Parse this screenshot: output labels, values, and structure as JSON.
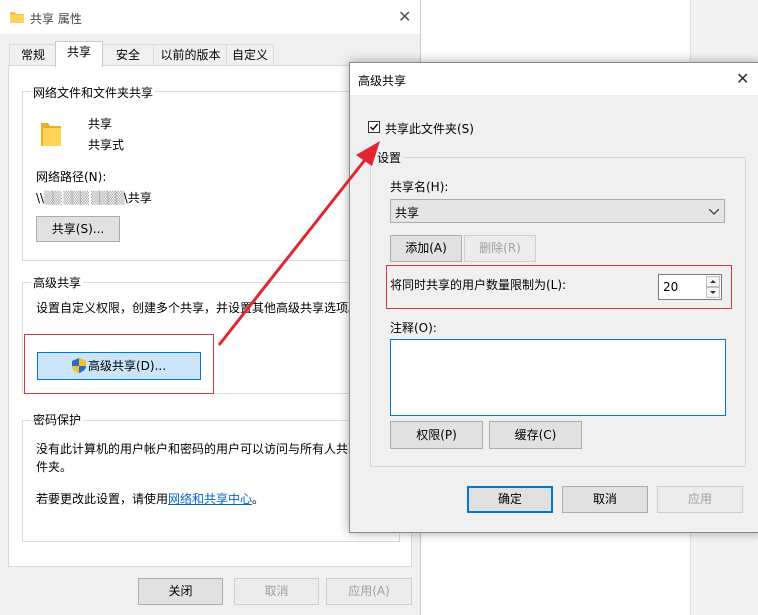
{
  "properties_window": {
    "title": "共享 属性",
    "tabs": [
      "常规",
      "共享",
      "安全",
      "以前的版本",
      "自定义"
    ],
    "network_share_group": "网络文件和文件夹共享",
    "folder_name": "共享",
    "folder_status": "共享式",
    "network_path_label": "网络路径(N):",
    "network_path_prefix": "\\\\",
    "network_path_masked": "▒▒ ▒▒▒ ▒▒▒▒",
    "network_path_suffix": "\\共享",
    "share_button": "共享(S)...",
    "advanced_group": "高级共享",
    "advanced_desc": "设置自定义权限，创建多个共享，并设置其他高级共享选项。",
    "advanced_button": "高级共享(D)...",
    "password_group": "密码保护",
    "password_desc_1": "没有此计算机的用户帐户和密码的用户可以访问与所有人共享的文",
    "password_desc_2": "件夹。",
    "password_change_prefix": "若要更改此设置，请使用",
    "password_link": "网络和共享中心",
    "password_change_suffix": "。",
    "ok_button": "关闭",
    "cancel_button": "取消",
    "apply_button": "应用(A)"
  },
  "advanced_dialog": {
    "title": "高级共享",
    "share_checkbox_label": "共享此文件夹(S)",
    "share_checked": true,
    "settings_group": "设置",
    "share_name_label": "共享名(H):",
    "share_name_value": "共享",
    "add_button": "添加(A)",
    "remove_button": "删除(R)",
    "limit_label": "将同时共享的用户数量限制为(L):",
    "limit_value": "20",
    "comment_label": "注释(O):",
    "comment_value": "",
    "permissions_button": "权限(P)",
    "caching_button": "缓存(C)",
    "ok_button": "确定",
    "cancel_button": "取消",
    "apply_button": "应用"
  },
  "annotation_color": "#d9363e"
}
